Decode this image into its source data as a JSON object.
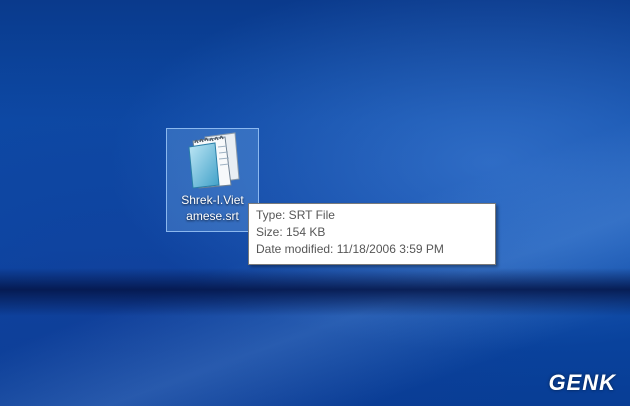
{
  "desktop": {
    "file": {
      "name": "Shrek-I.Vietnamese.srt",
      "label_line1": "Shrek-I.Viet",
      "label_line2": "amese.srt",
      "icon": "notepad-document-icon"
    },
    "tooltip": {
      "type": "Type: SRT File",
      "size": "Size: 154 KB",
      "date_modified": "Date modified: 11/18/2006 3:59 PM"
    }
  },
  "watermark": {
    "text": "GENK"
  },
  "colors": {
    "wallpaper": "#0c4aa6",
    "selection": "#6ea5e6",
    "tooltip_bg": "#ffffff"
  }
}
